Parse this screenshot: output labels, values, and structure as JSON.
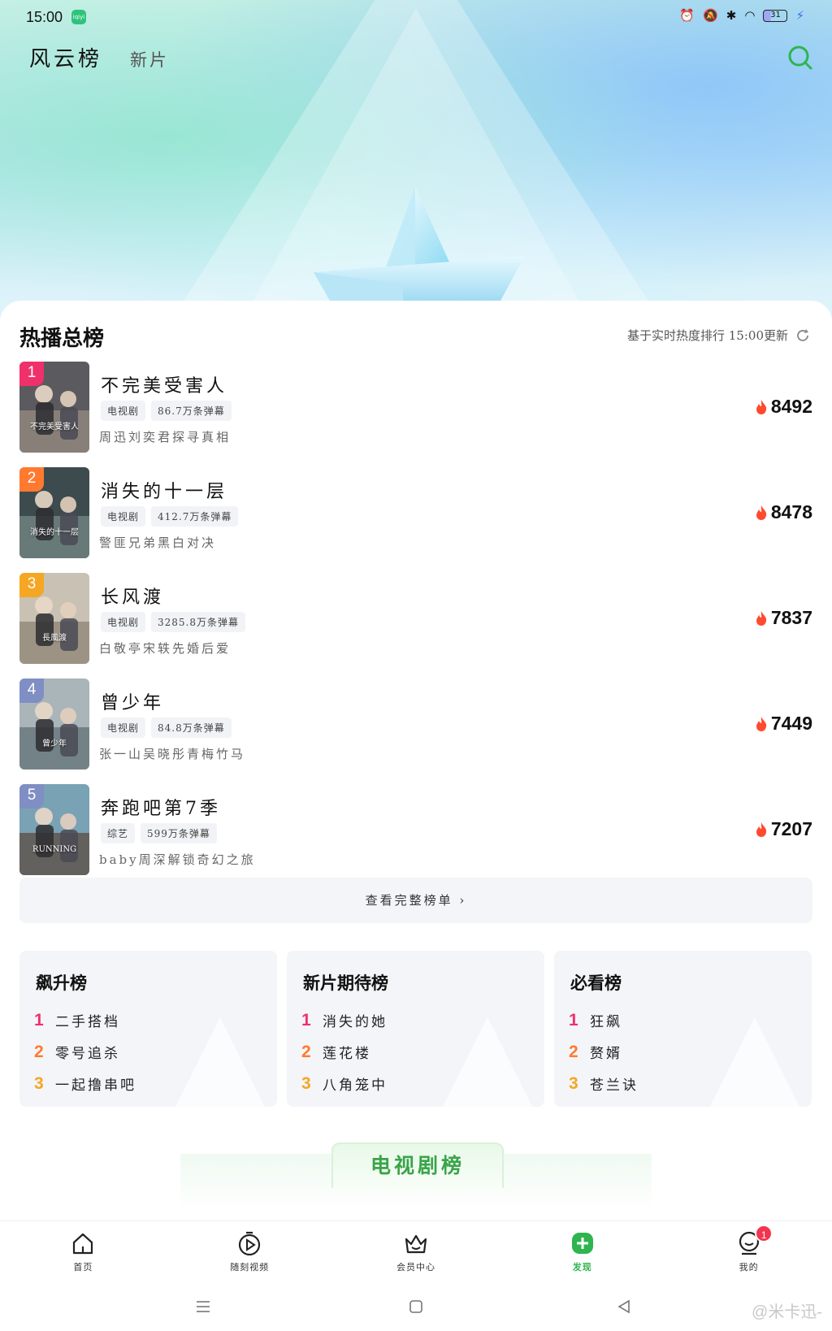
{
  "status": {
    "time": "15:00",
    "app_icon_text": "iqiyi",
    "battery": "31"
  },
  "topnav": {
    "active_tab": "风云榜",
    "tab2": "新片"
  },
  "hot_board": {
    "title": "热播总榜",
    "update_info": "基于实时热度排行  15:00更新",
    "items": [
      {
        "rank": "1",
        "title": "不完美受害人",
        "type": "电视剧",
        "danmaku": "86.7万条弹幕",
        "desc": "周迅刘奕君探寻真相",
        "heat": "8492",
        "poster_caption": "不完美受害人",
        "badge_color": "#f0306a"
      },
      {
        "rank": "2",
        "title": "消失的十一层",
        "type": "电视剧",
        "danmaku": "412.7万条弹幕",
        "desc": "警匪兄弟黑白对决",
        "heat": "8478",
        "poster_caption": "消失的十一层",
        "badge_color": "#ff7a2f"
      },
      {
        "rank": "3",
        "title": "长风渡",
        "type": "电视剧",
        "danmaku": "3285.8万条弹幕",
        "desc": "白敬亭宋轶先婚后爱",
        "heat": "7837",
        "poster_caption": "長風渡",
        "badge_color": "#f5a623"
      },
      {
        "rank": "4",
        "title": "曾少年",
        "type": "电视剧",
        "danmaku": "84.8万条弹幕",
        "desc": "张一山吴晓彤青梅竹马",
        "heat": "7449",
        "poster_caption": "曾少年",
        "badge_color": "#7f8fc4"
      },
      {
        "rank": "5",
        "title": "奔跑吧第7季",
        "type": "综艺",
        "danmaku": "599万条弹幕",
        "desc": "baby周深解锁奇幻之旅",
        "heat": "7207",
        "poster_caption": "RUNNING",
        "badge_color": "#7f8fc4"
      }
    ],
    "view_all": "查看完整榜单"
  },
  "mini_boards": [
    {
      "title": "飙升榜",
      "items": [
        "二手搭档",
        "零号追杀",
        "一起撸串吧"
      ]
    },
    {
      "title": "新片期待榜",
      "items": [
        "消失的她",
        "莲花楼",
        "八角笼中"
      ]
    },
    {
      "title": "必看榜",
      "items": [
        "狂飙",
        "赘婿",
        "苍兰诀"
      ]
    }
  ],
  "rank_numbers": [
    "1",
    "2",
    "3"
  ],
  "rank_colors": [
    "#f0306a",
    "#ff7a2f",
    "#f5a623"
  ],
  "tv_board_label": "电视剧榜",
  "bottom_nav": [
    {
      "label": "首页",
      "icon": "home-icon"
    },
    {
      "label": "随刻视频",
      "icon": "play-icon"
    },
    {
      "label": "会员中心",
      "icon": "crown-icon"
    },
    {
      "label": "发现",
      "icon": "discover-icon",
      "active": true
    },
    {
      "label": "我的",
      "icon": "profile-icon",
      "badge": "1"
    }
  ],
  "watermark": "@米卡迅-",
  "colors": {
    "accent": "#2fb450",
    "flame": "#ff4a2f"
  }
}
